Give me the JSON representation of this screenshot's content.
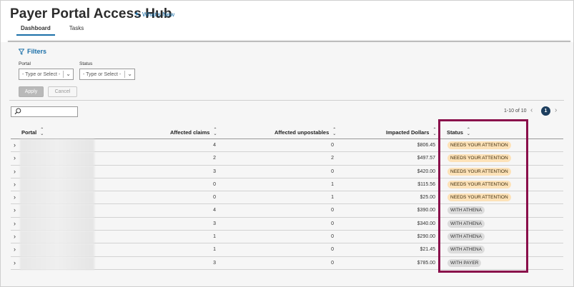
{
  "header": {
    "title": "Payer Portal Access Hub",
    "whats_new": "What's New",
    "tabs": [
      {
        "label": "Dashboard",
        "active": true
      },
      {
        "label": "Tasks",
        "active": false
      }
    ]
  },
  "filters": {
    "toggle_label": "Filters",
    "portal": {
      "label": "Portal",
      "placeholder": "- Type or Select -"
    },
    "status": {
      "label": "Status",
      "placeholder": "- Type or Select -"
    },
    "apply_label": "Apply",
    "cancel_label": "Cancel"
  },
  "search": {
    "placeholder": ""
  },
  "pagination": {
    "range_text": "1-10 of 10",
    "current_page": "1",
    "prev_glyph": "‹",
    "next_glyph": "›"
  },
  "table": {
    "columns": {
      "portal": "Portal",
      "affected_claims": "Affected claims",
      "affected_unpostables": "Affected unpostables",
      "impacted_dollars": "Impacted Dollars",
      "status": "Status"
    },
    "rows": [
      {
        "claims": "4",
        "unpostables": "0",
        "dollars": "$806.45",
        "status": "NEEDS YOUR ATTENTION",
        "status_type": "attn"
      },
      {
        "claims": "2",
        "unpostables": "2",
        "dollars": "$497.57",
        "status": "NEEDS YOUR ATTENTION",
        "status_type": "attn"
      },
      {
        "claims": "3",
        "unpostables": "0",
        "dollars": "$420.00",
        "status": "NEEDS YOUR ATTENTION",
        "status_type": "attn"
      },
      {
        "claims": "0",
        "unpostables": "1",
        "dollars": "$115.56",
        "status": "NEEDS YOUR ATTENTION",
        "status_type": "attn"
      },
      {
        "claims": "0",
        "unpostables": "1",
        "dollars": "$25.00",
        "status": "NEEDS YOUR ATTENTION",
        "status_type": "attn"
      },
      {
        "claims": "4",
        "unpostables": "0",
        "dollars": "$390.00",
        "status": "WITH ATHENA",
        "status_type": "athena"
      },
      {
        "claims": "3",
        "unpostables": "0",
        "dollars": "$340.00",
        "status": "WITH ATHENA",
        "status_type": "athena"
      },
      {
        "claims": "1",
        "unpostables": "0",
        "dollars": "$290.00",
        "status": "WITH ATHENA",
        "status_type": "athena"
      },
      {
        "claims": "1",
        "unpostables": "0",
        "dollars": "$21.45",
        "status": "WITH ATHENA",
        "status_type": "athena"
      },
      {
        "claims": "3",
        "unpostables": "0",
        "dollars": "$785.00",
        "status": "WITH PAYER",
        "status_type": "athena"
      }
    ]
  },
  "colors": {
    "accent": "#1a6fa8",
    "attention_badge": "#fde2b8",
    "neutral_badge": "#dcdcdc",
    "highlight_border": "#8a0f4b",
    "page_badge": "#1d3e5e"
  },
  "icons": {
    "whats_new": "sparkle-icon",
    "filters": "funnel-icon",
    "search": "search-icon",
    "sort": "sort-icon",
    "expand": "chevron-right-icon"
  }
}
